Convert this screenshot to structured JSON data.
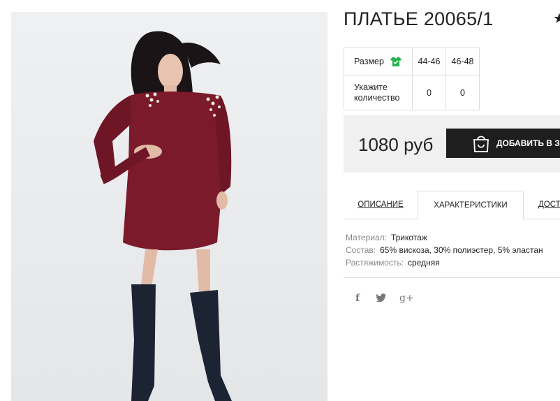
{
  "product": {
    "title": "ПЛАТЬЕ 20065/1",
    "image_alt": "dress photo",
    "price": "1080 руб",
    "cart_button": "ДОБАВИТЬ В ЗАК"
  },
  "size_table": {
    "size_label": "Размер",
    "sizes": [
      "44-46",
      "46-48"
    ],
    "qty_label_line1": "Укажите",
    "qty_label_line2": "количество",
    "quantities": [
      "0",
      "0"
    ]
  },
  "tabs": [
    {
      "label": "ОПИСАНИЕ"
    },
    {
      "label": "ХАРАКТЕРИСТИКИ"
    },
    {
      "label": "ДОСТА"
    }
  ],
  "specs": [
    {
      "key": "Материал:",
      "value": "Трикотаж"
    },
    {
      "key": "Состав:",
      "value": "65% вискоза, 30% полиэстер, 5% эластан"
    },
    {
      "key": "Растяжимость:",
      "value": "средняя"
    }
  ],
  "social": {
    "facebook": "f",
    "twitter": "t",
    "gplus": "g+"
  },
  "colors": {
    "dress": "#7a1a2a",
    "accent_green": "#22b14c",
    "button_bg": "#1e1e1e"
  }
}
